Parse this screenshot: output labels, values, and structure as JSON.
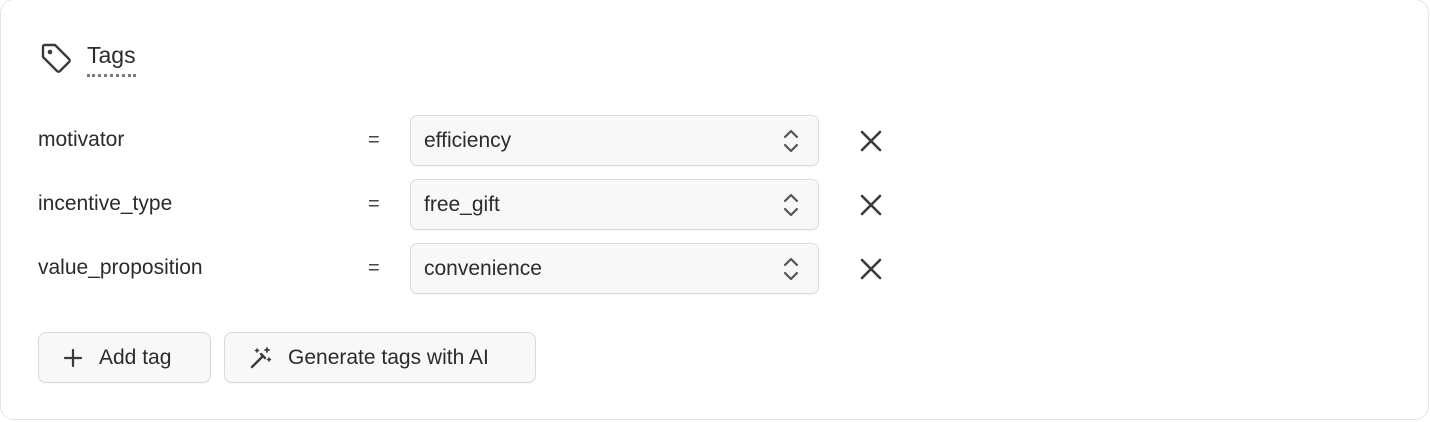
{
  "section": {
    "title": "Tags",
    "icon": "tag-icon"
  },
  "tags": [
    {
      "key": "motivator",
      "operator": "=",
      "value": "efficiency"
    },
    {
      "key": "incentive_type",
      "operator": "=",
      "value": "free_gift"
    },
    {
      "key": "value_proposition",
      "operator": "=",
      "value": "convenience"
    }
  ],
  "actions": {
    "add_tag_label": "Add tag",
    "generate_label": "Generate tags with AI"
  }
}
